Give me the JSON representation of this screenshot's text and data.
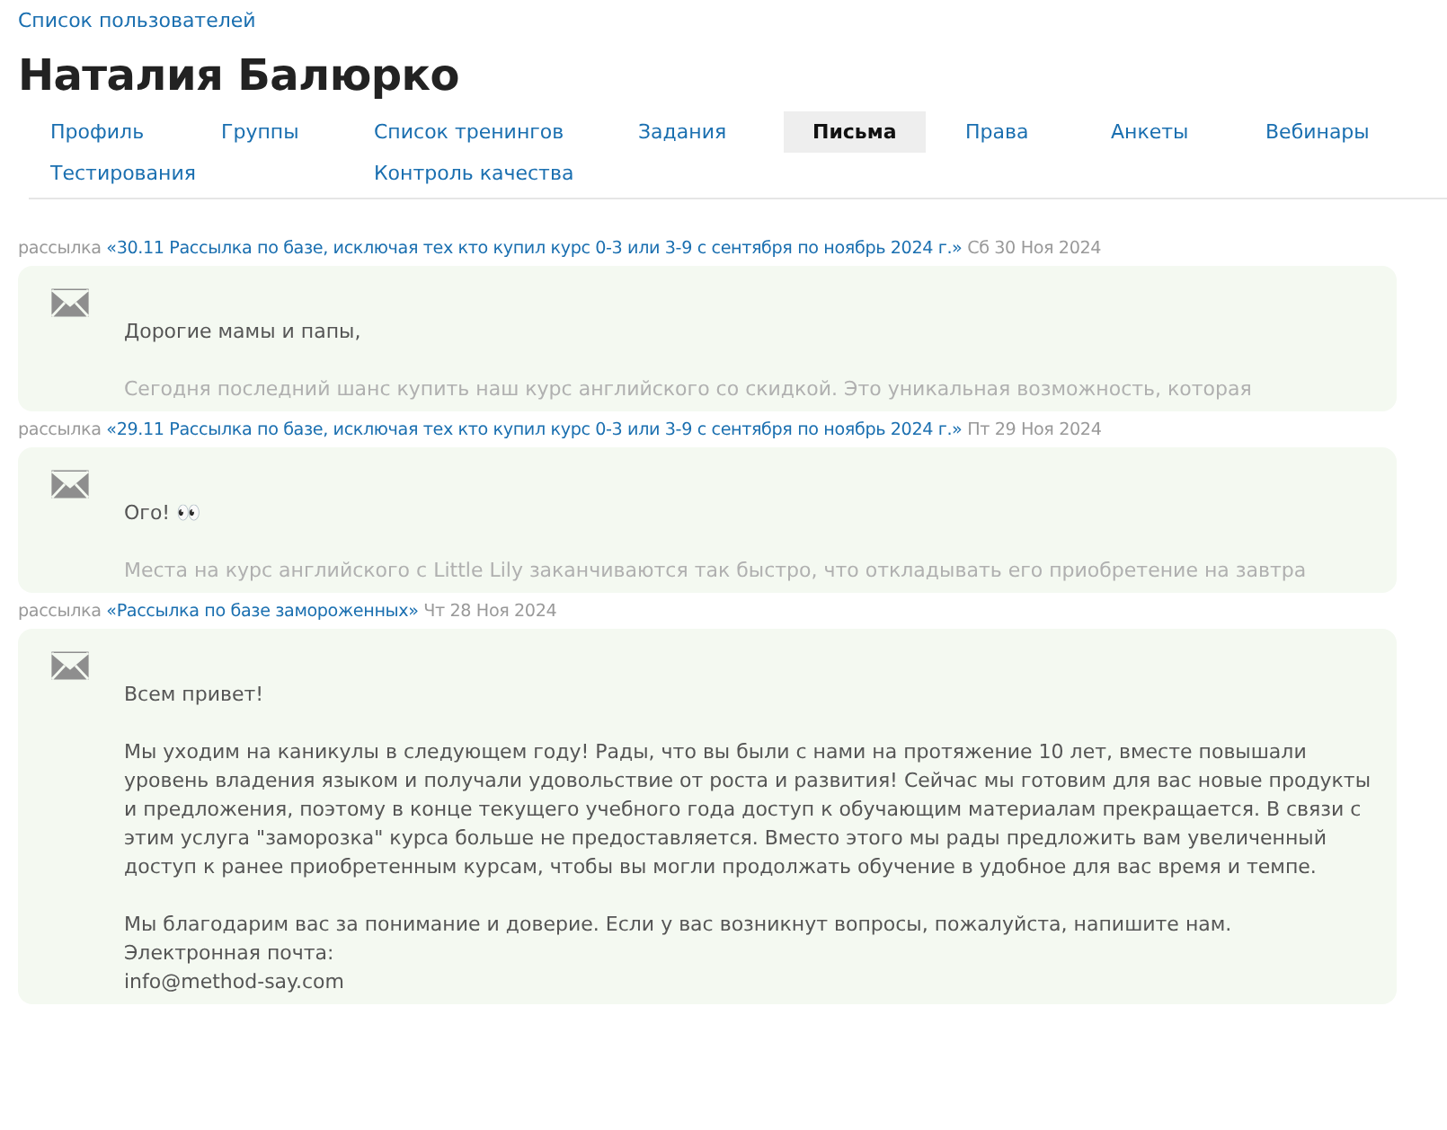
{
  "breadcrumb": "Список пользователей",
  "title": "Наталия Балюрко",
  "tabs": [
    {
      "label": "Профиль",
      "selected": false
    },
    {
      "label": "Группы",
      "selected": false
    },
    {
      "label": "Список тренингов",
      "selected": false
    },
    {
      "label": "Задания",
      "selected": false
    },
    {
      "label": "Письма",
      "selected": true
    },
    {
      "label": "Права",
      "selected": false
    },
    {
      "label": "Анкеты",
      "selected": false
    },
    {
      "label": "Вебинары",
      "selected": false
    },
    {
      "label": "Тестирования",
      "selected": false
    },
    {
      "label": "Контроль качества",
      "selected": false
    }
  ],
  "letters": [
    {
      "type_label": "рассылка",
      "subject": "«30.11 Рассылка по базе, исключая тех кто купил курс 0-3 или 3-9 с сентября по ноябрь 2024 г.»",
      "date": "Сб 30 Ноя 2024",
      "paragraphs": [
        {
          "lines": [
            "Дорогие мамы и папы,"
          ],
          "faded": false
        },
        {
          "lines": [
            "Сегодня последний шанс купить наш курс английского со скидкой. Это уникальная возможность, которая"
          ],
          "faded": true
        }
      ]
    },
    {
      "type_label": "рассылка",
      "subject": "«29.11 Рассылка по базе, исключая тех кто купил курс 0-3 или 3-9 с сентября по ноябрь 2024 г.»",
      "date": "Пт 29 Ноя 2024",
      "paragraphs": [
        {
          "lines": [
            "Ого! 👀"
          ],
          "faded": false
        },
        {
          "lines": [
            "Места на курс английского с Little Lily заканчиваются так быстро, что откладывать его приобретение на завтра"
          ],
          "faded": true
        }
      ]
    },
    {
      "type_label": "рассылка",
      "subject": "«Рассылка по базе замороженных»",
      "date": "Чт 28 Ноя 2024",
      "paragraphs": [
        {
          "lines": [
            "Всем привет!"
          ],
          "faded": false
        },
        {
          "lines": [
            "Мы уходим на каникулы в следующем году! Рады, что вы были с нами на протяжение 10 лет, вместе повышали уровень владения языком и получали удовольствие от роста и развития! Сейчас мы готовим для вас новые продукты и предложения, поэтому в конце текущего учебного года доступ к обучающим материалам прекращается. В связи с этим услуга \"заморозка\" курса больше не предоставляется. Вместо этого мы рады предложить вам увеличенный доступ к ранее приобретенным курсам, чтобы вы могли продолжать обучение в удобное для вас время и темпе."
          ],
          "faded": false
        },
        {
          "lines": [
            "Мы благодарим вас за понимание и доверие. Если у вас возникнут вопросы, пожалуйста, напишите нам.",
            "Электронная почта:",
            "info@method-say.com"
          ],
          "faded": false
        }
      ]
    }
  ]
}
